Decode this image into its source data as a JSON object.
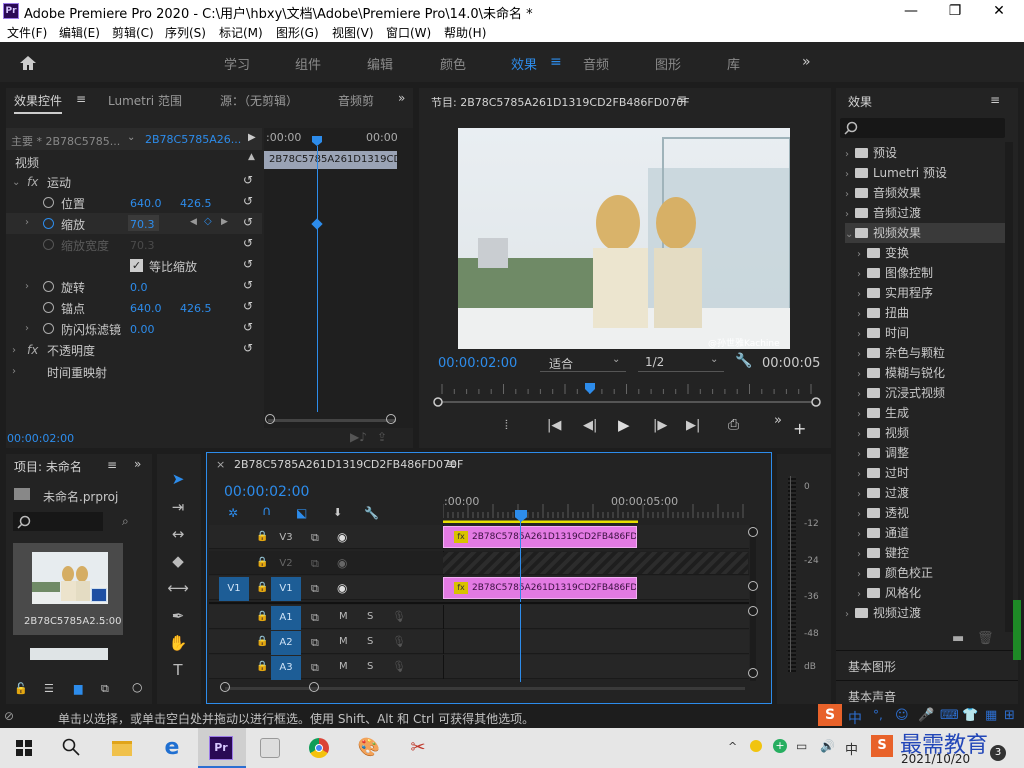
{
  "window": {
    "title": "Adobe Premiere Pro 2020 - C:\\用户\\hbxy\\文档\\Adobe\\Premiere Pro\\14.0\\未命名 *",
    "logo": "Pr",
    "minimize": "—",
    "maximize": "❐",
    "close": "✕"
  },
  "menu": [
    "文件(F)",
    "编辑(E)",
    "剪辑(C)",
    "序列(S)",
    "标记(M)",
    "图形(G)",
    "视图(V)",
    "窗口(W)",
    "帮助(H)"
  ],
  "workspaces": [
    "学习",
    "组件",
    "编辑",
    "颜色",
    "效果",
    "音频",
    "图形",
    "库"
  ],
  "workspace_active": "效果",
  "effect_controls": {
    "tabs": [
      "效果控件",
      "Lumetri 范围",
      "源：（无剪辑）",
      "音频剪"
    ],
    "master": "主要 * 2B78C5785...",
    "clip": "2B78C5785A26...",
    "time_start": ":00:00",
    "time_end": "00:00",
    "mini_clip": "2B78C5785A261D1319CD",
    "video_header": "视频",
    "motion": "运动",
    "position": "位置",
    "position_x": "640.0",
    "position_y": "426.5",
    "scale": "缩放",
    "scale_val": "70.3",
    "scale_width": "缩放宽度",
    "scale_width_val": "70.3",
    "uniform_scale": "等比缩放",
    "rotation": "旋转",
    "rotation_val": "0.0",
    "anchor": "锚点",
    "anchor_x": "640.0",
    "anchor_y": "426.5",
    "anti_flicker": "防闪烁滤镜",
    "anti_flicker_val": "0.00",
    "opacity": "不透明度",
    "time_remap": "时间重映射",
    "timecode": "00:00:02:00"
  },
  "program": {
    "title": "节目: 2B78C5785A261D1319CD2FB486FD070F",
    "timecode": "00:00:02:00",
    "fit": "适合",
    "resolution": "1/2",
    "duration": "00:00:05",
    "watermark": "@孙世雅Kachine",
    "playhead": 0.4
  },
  "effects_panel": {
    "title": "效果",
    "items": [
      {
        "label": "预设",
        "level": 0,
        "open": false
      },
      {
        "label": "Lumetri 预设",
        "level": 0,
        "open": false
      },
      {
        "label": "音频效果",
        "level": 0,
        "open": false
      },
      {
        "label": "音频过渡",
        "level": 0,
        "open": false
      },
      {
        "label": "视频效果",
        "level": 0,
        "open": true
      },
      {
        "label": "变换",
        "level": 1,
        "open": false
      },
      {
        "label": "图像控制",
        "level": 1,
        "open": false
      },
      {
        "label": "实用程序",
        "level": 1,
        "open": false
      },
      {
        "label": "扭曲",
        "level": 1,
        "open": false
      },
      {
        "label": "时间",
        "level": 1,
        "open": false
      },
      {
        "label": "杂色与颗粒",
        "level": 1,
        "open": false
      },
      {
        "label": "模糊与锐化",
        "level": 1,
        "open": false
      },
      {
        "label": "沉浸式视频",
        "level": 1,
        "open": false
      },
      {
        "label": "生成",
        "level": 1,
        "open": false
      },
      {
        "label": "视频",
        "level": 1,
        "open": false
      },
      {
        "label": "调整",
        "level": 1,
        "open": false
      },
      {
        "label": "过时",
        "level": 1,
        "open": false
      },
      {
        "label": "过渡",
        "level": 1,
        "open": false
      },
      {
        "label": "透视",
        "level": 1,
        "open": false
      },
      {
        "label": "通道",
        "level": 1,
        "open": false
      },
      {
        "label": "键控",
        "level": 1,
        "open": false
      },
      {
        "label": "颜色校正",
        "level": 1,
        "open": false
      },
      {
        "label": "风格化",
        "level": 1,
        "open": false
      },
      {
        "label": "视频过渡",
        "level": 0,
        "open": false
      }
    ],
    "basic_graphics": "基本图形",
    "basic_audio": "基本声音"
  },
  "project": {
    "tab": "项目: 未命名",
    "file": "未命名.prproj",
    "clip_name": "2B78C5785A2...",
    "clip_duration": "5:00"
  },
  "timeline": {
    "tab": "2B78C5785A261D1319CD2FB486FD070F",
    "timecode": "00:00:02:00",
    "ruler_start": ":00:00",
    "ruler_mid": "00:00:05:00",
    "tracks": [
      "V3",
      "V2",
      "V1",
      "A1",
      "A2",
      "A3"
    ],
    "source_v": "V1",
    "clip_v3": "2B78C5785A261D1319CD2FB486FD07",
    "clip_v1": "2B78C5785A261D1319CD2FB486FD070",
    "mute": "M",
    "solo": "S"
  },
  "meter": {
    "labels": [
      "0",
      "-12",
      "-24",
      "-36",
      "-48",
      "dB"
    ]
  },
  "status": "单击以选择，或单击空白处并拖动以进行框选。使用 Shift、Alt 和 Ctrl 可获得其他选项。",
  "tray": {
    "ime": "中",
    "time": "2021/10/20",
    "brand": "最需教育",
    "notifications": "3"
  }
}
